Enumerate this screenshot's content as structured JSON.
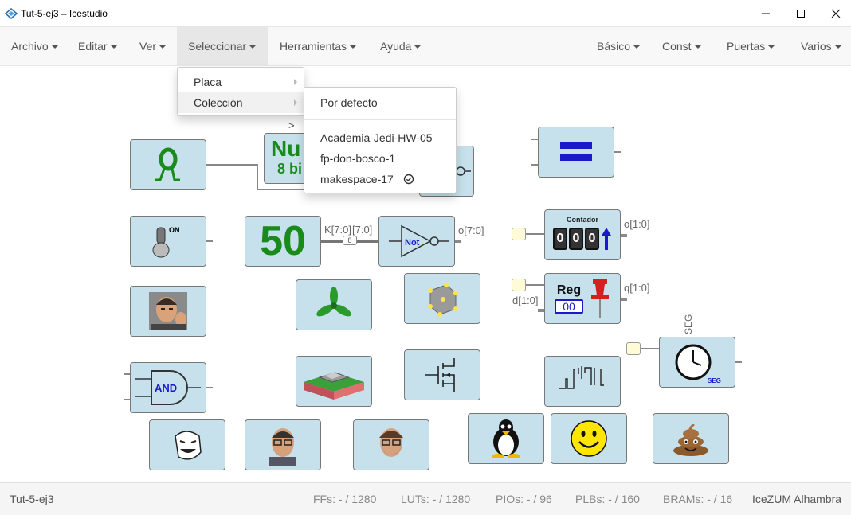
{
  "window": {
    "title": "Tut-5-ej3 – Icestudio",
    "minimize_label": "—",
    "maximize_label": "☐",
    "close_label": "✕"
  },
  "menubar": {
    "left": [
      {
        "label": "Archivo"
      },
      {
        "label": "Editar"
      },
      {
        "label": "Ver"
      },
      {
        "label": "Seleccionar"
      },
      {
        "label": "Herramientas"
      },
      {
        "label": "Ayuda"
      }
    ],
    "right": [
      {
        "label": "Básico"
      },
      {
        "label": "Const"
      },
      {
        "label": "Puertas"
      },
      {
        "label": "Varios"
      }
    ]
  },
  "select_menu": {
    "items": [
      {
        "label": "Placa"
      },
      {
        "label": "Colección"
      }
    ]
  },
  "collection_submenu": {
    "default_label": "Por defecto",
    "items": [
      {
        "label": "Academia-Jedi-HW-05",
        "checked": false
      },
      {
        "label": "fp-don-bosco-1",
        "checked": false
      },
      {
        "label": "makespace-17",
        "checked": true
      }
    ]
  },
  "canvas": {
    "blocks": {
      "num_text": "Nu",
      "num_sub": "8 bi",
      "const_value": "50",
      "bus_label_k": "K[7:0]",
      "bus_label_in": "[7:0]",
      "bus_width": "8",
      "not_label": "Not",
      "not_out": "o[7:0]",
      "counter_title": "Contador",
      "counter_digits": [
        "0",
        "0",
        "0"
      ],
      "counter_out": "o[1:0]",
      "reg_title": "Reg",
      "reg_value": "00",
      "reg_in": "d[1:0]",
      "reg_out": "q[1:0]",
      "timer_top": "SEG",
      "timer_unit": "SEG",
      "and_label": "AND",
      "switch_label": "ON",
      "arrow_glyph": ">"
    }
  },
  "statusbar": {
    "project": "Tut-5-ej3",
    "ffs_label": "FFs:",
    "ffs_value": "- / 1280",
    "luts_label": "LUTs:",
    "luts_value": "- / 1280",
    "pios_label": "PIOs:",
    "pios_value": "- / 96",
    "plbs_label": "PLBs:",
    "plbs_value": "- / 160",
    "brams_label": "BRAMs:",
    "brams_value": "- / 16",
    "board": "IceZUM Alhambra"
  },
  "colors": {
    "block_fill": "#c6e1ec",
    "green": "#1a8a1a",
    "blue": "#1a1acc",
    "red": "#d42020"
  }
}
